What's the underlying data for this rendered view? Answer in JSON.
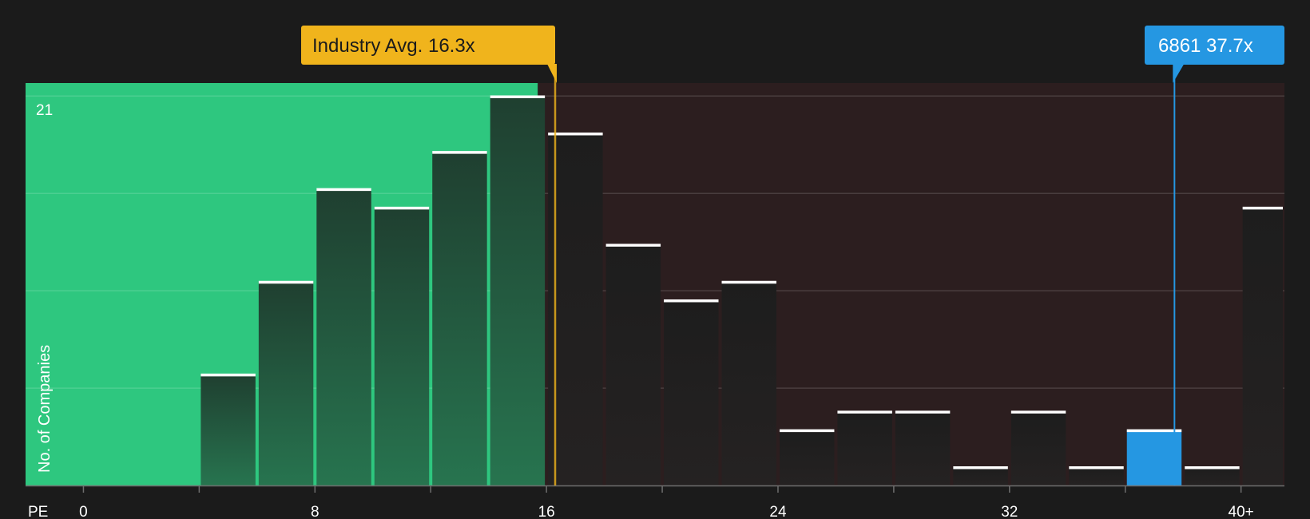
{
  "chart_data": {
    "type": "bar",
    "title": "",
    "xlabel": "PE",
    "ylabel": "No. of Companies",
    "xlim": [
      -2,
      41.5
    ],
    "ylim": [
      0,
      21.7
    ],
    "bin_width": 2,
    "bins": [
      {
        "x0": -2,
        "value": 0
      },
      {
        "x0": 0,
        "value": 0
      },
      {
        "x0": 2,
        "value": 0
      },
      {
        "x0": 4,
        "value": 6
      },
      {
        "x0": 6,
        "value": 11
      },
      {
        "x0": 8,
        "value": 16
      },
      {
        "x0": 10,
        "value": 15
      },
      {
        "x0": 12,
        "value": 18
      },
      {
        "x0": 14,
        "value": 21
      },
      {
        "x0": 16,
        "value": 19
      },
      {
        "x0": 18,
        "value": 13
      },
      {
        "x0": 20,
        "value": 10
      },
      {
        "x0": 22,
        "value": 11
      },
      {
        "x0": 24,
        "value": 3
      },
      {
        "x0": 26,
        "value": 4
      },
      {
        "x0": 28,
        "value": 4
      },
      {
        "x0": 30,
        "value": 1
      },
      {
        "x0": 32,
        "value": 4
      },
      {
        "x0": 34,
        "value": 1
      },
      {
        "x0": 36,
        "value": 3
      },
      {
        "x0": 38,
        "value": 1
      },
      {
        "x0": 40,
        "value": 15
      }
    ],
    "x_ticks": [
      {
        "value": 0,
        "label": "0"
      },
      {
        "value": 8,
        "label": "8"
      },
      {
        "value": 16,
        "label": "16"
      },
      {
        "value": 24,
        "label": "24"
      },
      {
        "value": 32,
        "label": "32"
      },
      {
        "value": 40,
        "label": "40+"
      }
    ],
    "y_max_label": "21",
    "y_max_value": 21,
    "highlight_threshold": 15.7,
    "industry_avg": {
      "value": 16.3,
      "label": "Industry Avg. 16.3x"
    },
    "company": {
      "value": 37.7,
      "label": "6861 37.7x",
      "bin_x0": 36
    },
    "colors": {
      "background": "#1b1b1b",
      "undervalued_zone": "#2ec77f",
      "overvalued_zone": "#2c1e1f",
      "industry_marker": "#f0b41c",
      "company_marker": "#2597e2",
      "bar_cap": "#ffffff"
    }
  }
}
